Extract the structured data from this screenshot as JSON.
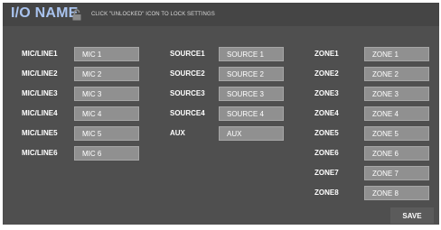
{
  "header": {
    "title": "I/O NAME",
    "hint": "CLICK \"UNLOCKED\" ICON TO LOCK SETTINGS",
    "lock_icon": "unlocked-padlock-icon"
  },
  "mics": [
    {
      "label": "MIC/LINE1",
      "value": "MIC 1"
    },
    {
      "label": "MIC/LINE2",
      "value": "MIC 2"
    },
    {
      "label": "MIC/LINE3",
      "value": "MIC 3"
    },
    {
      "label": "MIC/LINE4",
      "value": "MIC 4"
    },
    {
      "label": "MIC/LINE5",
      "value": "MIC 5"
    },
    {
      "label": "MIC/LINE6",
      "value": "MIC 6"
    }
  ],
  "sources": [
    {
      "label": "SOURCE1",
      "value": "SOURCE 1"
    },
    {
      "label": "SOURCE2",
      "value": "SOURCE 2"
    },
    {
      "label": "SOURCE3",
      "value": "SOURCE 3"
    },
    {
      "label": "SOURCE4",
      "value": "SOURCE 4"
    },
    {
      "label": "AUX",
      "value": "AUX"
    }
  ],
  "zones": [
    {
      "label": "ZONE1",
      "value": "ZONE 1"
    },
    {
      "label": "ZONE2",
      "value": "ZONE 2"
    },
    {
      "label": "ZONE3",
      "value": "ZONE 3"
    },
    {
      "label": "ZONE4",
      "value": "ZONE 4"
    },
    {
      "label": "ZONE5",
      "value": "ZONE 5"
    },
    {
      "label": "ZONE6",
      "value": "ZONE 6"
    },
    {
      "label": "ZONE7",
      "value": "ZONE 7"
    },
    {
      "label": "ZONE8",
      "value": "ZONE 8"
    }
  ],
  "save_label": "SAVE",
  "colors": {
    "panel": "#4f4f4f",
    "title": "#a9c3ee",
    "field": "#909090"
  }
}
